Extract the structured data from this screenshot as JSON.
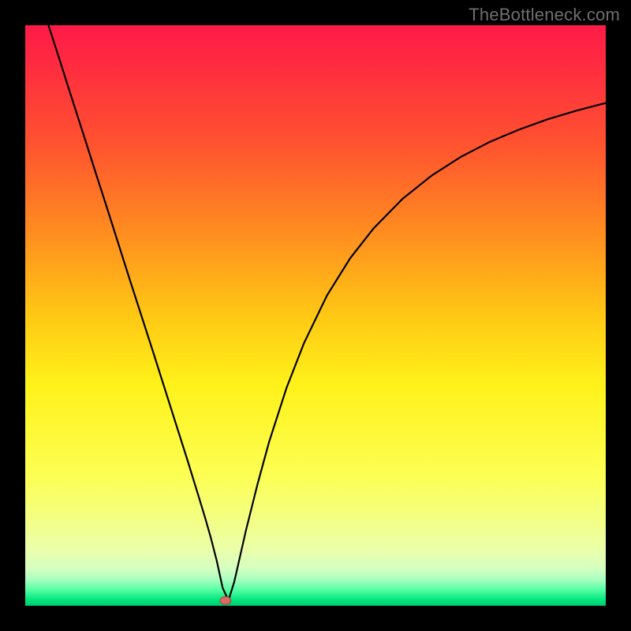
{
  "watermark": "TheBottleneck.com",
  "colors": {
    "frame": "#000000",
    "curve": "#000000",
    "dot_fill": "#d86b62",
    "dot_stroke": "#9e4a44",
    "gradient_stops": [
      {
        "offset": 0.0,
        "color": "#ff1a47"
      },
      {
        "offset": 0.08,
        "color": "#ff2f3f"
      },
      {
        "offset": 0.2,
        "color": "#ff5130"
      },
      {
        "offset": 0.35,
        "color": "#ff8a20"
      },
      {
        "offset": 0.5,
        "color": "#ffc814"
      },
      {
        "offset": 0.62,
        "color": "#fff21a"
      },
      {
        "offset": 0.78,
        "color": "#fcff55"
      },
      {
        "offset": 0.86,
        "color": "#f2ff8a"
      },
      {
        "offset": 0.905,
        "color": "#eaffab"
      },
      {
        "offset": 0.935,
        "color": "#d6ffc0"
      },
      {
        "offset": 0.955,
        "color": "#a8ffc0"
      },
      {
        "offset": 0.972,
        "color": "#57ffa5"
      },
      {
        "offset": 0.99,
        "color": "#00e57e"
      },
      {
        "offset": 1.0,
        "color": "#00cc70"
      }
    ]
  },
  "chart_data": {
    "type": "line",
    "title": "",
    "xlabel": "",
    "ylabel": "",
    "xlim": [
      0,
      100
    ],
    "ylim": [
      0,
      100
    ],
    "grid": false,
    "legend": false,
    "series": [
      {
        "name": "bottleneck-curve",
        "x": [
          4,
          6,
          8,
          10,
          12,
          14,
          16,
          18,
          20,
          22,
          24,
          26,
          28,
          30,
          31,
          32,
          33,
          34,
          35,
          36,
          38,
          40,
          42,
          45,
          48,
          52,
          56,
          60,
          65,
          70,
          75,
          80,
          85,
          90,
          95,
          100
        ],
        "y": [
          100,
          93.8,
          87.5,
          81.3,
          75,
          68.8,
          62.5,
          56.2,
          50,
          43.8,
          37.5,
          31.2,
          24.9,
          18.4,
          15.1,
          11.6,
          7.7,
          3.1,
          0.9,
          4.1,
          12.9,
          20.9,
          28.2,
          37.5,
          45.2,
          53.5,
          59.9,
          65,
          70.1,
          74.1,
          77.3,
          79.9,
          82,
          83.8,
          85.3,
          86.6
        ]
      }
    ],
    "marker": {
      "x": 34.5,
      "y": 0.9,
      "label": "optimal-point"
    }
  }
}
